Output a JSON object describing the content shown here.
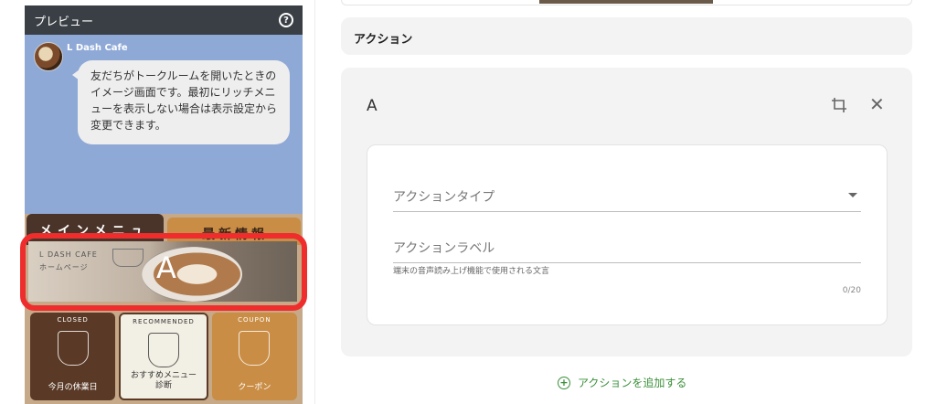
{
  "preview": {
    "title": "プレビュー",
    "help_icon": "?",
    "account_name": "L Dash Cafe",
    "message": "友だちがトークルームを開いたときのイメージ画面です。最初にリッチメニューを表示しない場合は表示設定から変更できます。",
    "tabs": [
      "メインメニュー",
      "最新情報"
    ],
    "banner_text": [
      "L DASH CAFE",
      "ホームページ"
    ],
    "banner_letter": "A",
    "tiles": [
      {
        "top": "CLOSED",
        "label": "今月の休業日"
      },
      {
        "top": "RECOMMENDED",
        "label": "おすすめメニュー\n診断"
      },
      {
        "top": "COUPON",
        "label": "クーポン"
      }
    ],
    "highlight_color": "#ef2d2d"
  },
  "panel": {
    "section_title": "アクション",
    "card_title": "A",
    "action_type_placeholder": "アクションタイプ",
    "action_label_placeholder": "アクションラベル",
    "hint": "端末の音声読み上げ機能で使用される文言",
    "counter": "0/20",
    "add_action": "アクションを追加する",
    "accent_color": "#3a8f3a"
  }
}
